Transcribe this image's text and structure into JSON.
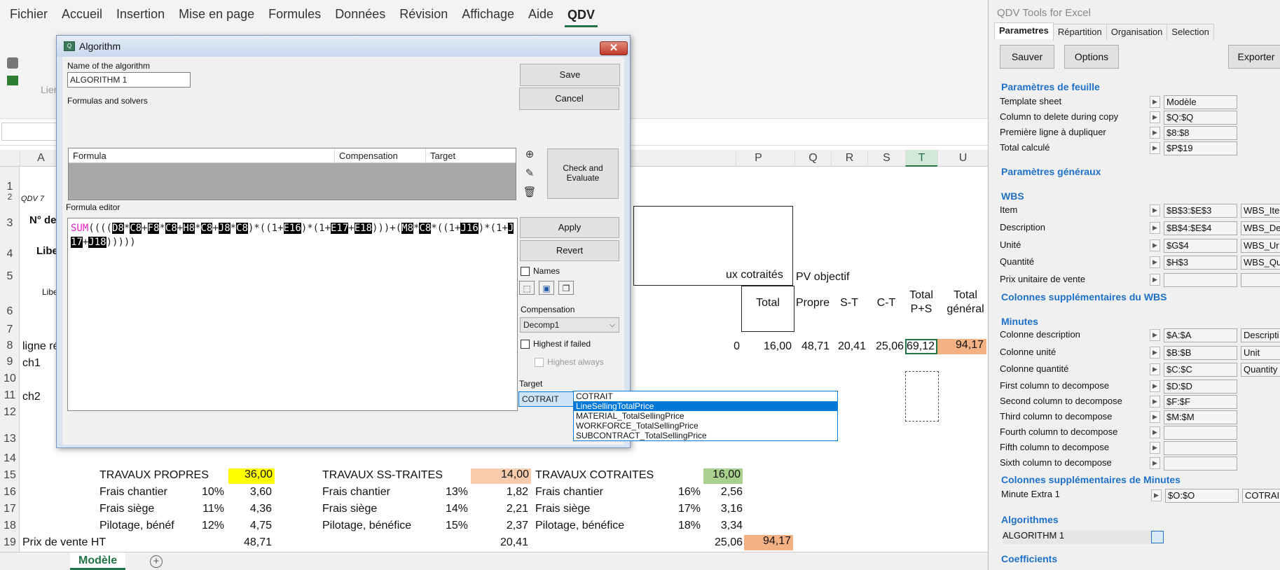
{
  "ribbon": {
    "tabs": [
      "Fichier",
      "Accueil",
      "Insertion",
      "Mise en page",
      "Formules",
      "Données",
      "Révision",
      "Affichage",
      "Aide",
      "QDV"
    ],
    "active_tab": "QDV",
    "partial_label": "Lier"
  },
  "sheet": {
    "col_letters": [
      "A",
      "P",
      "Q",
      "R",
      "S",
      "T",
      "U"
    ],
    "row_numbers": [
      "1",
      "2",
      "3",
      "4",
      "5",
      "6",
      "7",
      "8",
      "9",
      "10",
      "11",
      "12",
      "13",
      "14",
      "15",
      "16",
      "17",
      "18",
      "19"
    ],
    "cells": {
      "qdv7": "QDV 7",
      "num": "N° de p",
      "libel": "Libell",
      "libel2": "Libell",
      "ligne_ref": "ligne réf",
      "ch1": "ch1",
      "ch2": "ch2",
      "t13": "T",
      "cotraites_hdr": "ux cotraités",
      "pv_objectif": "PV objectif",
      "total": "Total",
      "propre": "Propre",
      "st": "S-T",
      "ct": "C-T",
      "total_ps": "Total P+S",
      "total_general": "Total général",
      "r8_o": "0",
      "r8_p": "16,00",
      "r8_q": "48,71",
      "r8_r": "20,41",
      "r8_s": "25,06",
      "r8_t": "69,12",
      "r8_u": "94,17",
      "trav_propres": "TRAVAUX PROPRES",
      "trav_propres_v": "36,00",
      "trav_ss": "TRAVAUX SS-TRAITES",
      "trav_ss_v": "14,00",
      "trav_co": "TRAVAUX COTRAITES",
      "trav_co_v": "16,00",
      "frais_chantier": "Frais chantier",
      "frais_siege": "Frais siège",
      "pilotage": "Pilotage, bénéf",
      "pilotage2": "Pilotage, bénéfice",
      "fc1_pct": "10%",
      "fc1_v": "3,60",
      "fs1_pct": "11%",
      "fs1_v": "4,36",
      "pb1_pct": "12%",
      "pb1_v": "4,75",
      "fc2_pct": "13%",
      "fc2_v": "1,82",
      "fs2_pct": "14%",
      "fs2_v": "2,21",
      "pb2_pct": "15%",
      "pb2_v": "2,37",
      "fc3_pct": "16%",
      "fc3_v": "2,56",
      "fs3_pct": "17%",
      "fs3_v": "3,16",
      "pb3_pct": "18%",
      "pb3_v": "3,34",
      "prix_vente": "Prix de vente HT",
      "pv1": "48,71",
      "pv2": "20,41",
      "pv3": "25,06",
      "pv4": "94,17"
    },
    "sheet_tab": "Modèle",
    "add_sheet": "+"
  },
  "qdv_panel": {
    "title": "QDV Tools for Excel",
    "tabs": [
      "Parametres",
      "Répartition",
      "Organisation",
      "Selection"
    ],
    "buttons": {
      "save": "Sauver",
      "options": "Options",
      "export": "Exporter"
    },
    "sections": {
      "feuille": "Paramètres de feuille",
      "generaux": "Paramètres généraux",
      "wbs": "WBS",
      "cols_wbs": "Colonnes supplémentaires du WBS",
      "minutes": "Minutes",
      "cols_minutes": "Colonnes supplémentaires de Minutes",
      "algorithmes": "Algorithmes",
      "coefficients": "Coefficients"
    },
    "feuille_rows": [
      {
        "label": "Template sheet",
        "value": "Modèle"
      },
      {
        "label": "Column to delete during copy",
        "value": "$Q:$Q"
      },
      {
        "label": "Première ligne à dupliquer",
        "value": "$8:$8"
      },
      {
        "label": "Total calculé",
        "value": "$P$19"
      }
    ],
    "wbs_rows": [
      {
        "label": "Item",
        "value": "$B$3:$E$3",
        "extra": "WBS_Ite"
      },
      {
        "label": "Description",
        "value": "$B$4:$E$4",
        "extra": "WBS_De"
      },
      {
        "label": "Unité",
        "value": "$G$4",
        "extra": "WBS_Ur"
      },
      {
        "label": "Quantité",
        "value": "$H$3",
        "extra": "WBS_Qu"
      },
      {
        "label": "Prix unitaire de vente",
        "value": "",
        "extra": ""
      }
    ],
    "minutes_rows": [
      {
        "label": "Colonne description",
        "value": "$A:$A",
        "extra": "Descripti"
      },
      {
        "label": "Colonne unité",
        "value": "$B:$B",
        "extra": "Unit"
      },
      {
        "label": "Colonne quantité",
        "value": "$C:$C",
        "extra": "Quantity"
      },
      {
        "label": "First column to decompose",
        "value": "$D:$D"
      },
      {
        "label": "Second column to decompose",
        "value": "$F:$F"
      },
      {
        "label": "Third column to decompose",
        "value": "$M:$M"
      },
      {
        "label": "Fourth column to decompose",
        "value": ""
      },
      {
        "label": "Fifth column to decompose",
        "value": ""
      },
      {
        "label": "Sixth column to decompose",
        "value": ""
      }
    ],
    "minute_extra": {
      "label": "Minute Extra 1",
      "value": "$O:$O",
      "extra": "COTRAI"
    },
    "algorithm_item": "ALGORITHM 1"
  },
  "dialog": {
    "title": "Algorithm",
    "close_glyph": "✕",
    "name_label": "Name of the algorithm",
    "name_value": "ALGORITHM 1",
    "formulas_label": "Formulas and solvers",
    "grid_headers": [
      "Formula",
      "Compensation",
      "Target"
    ],
    "editor_label": "Formula editor",
    "formula_tokens": [
      {
        "t": "SUM",
        "k": "fn"
      },
      {
        "t": "(((("
      },
      {
        "t": "D8",
        "k": "ref"
      },
      {
        "t": "*"
      },
      {
        "t": "C8",
        "k": "ref"
      },
      {
        "t": "+"
      },
      {
        "t": "F8",
        "k": "ref"
      },
      {
        "t": "*"
      },
      {
        "t": "C8",
        "k": "ref"
      },
      {
        "t": "+"
      },
      {
        "t": "H8",
        "k": "ref"
      },
      {
        "t": "*"
      },
      {
        "t": "C8",
        "k": "ref"
      },
      {
        "t": "+"
      },
      {
        "t": "J8",
        "k": "ref"
      },
      {
        "t": "*"
      },
      {
        "t": "C8",
        "k": "ref"
      },
      {
        "t": ")*((1+"
      },
      {
        "t": "E16",
        "k": "ref"
      },
      {
        "t": ")*(1+"
      },
      {
        "t": "E17",
        "k": "ref"
      },
      {
        "t": "+"
      },
      {
        "t": "E18",
        "k": "ref"
      },
      {
        "t": ")))+("
      },
      {
        "t": "M8",
        "k": "ref"
      },
      {
        "t": "*"
      },
      {
        "t": "C8",
        "k": "ref"
      },
      {
        "t": "*((1+"
      },
      {
        "t": "J16",
        "k": "ref"
      },
      {
        "t": ")*(1+"
      },
      {
        "t": "J17",
        "k": "ref"
      },
      {
        "t": "+"
      },
      {
        "t": "J18",
        "k": "ref"
      },
      {
        "t": ")))))"
      }
    ],
    "buttons": {
      "save": "Save",
      "cancel": "Cancel",
      "check": "Check and Evaluate",
      "apply": "Apply",
      "revert": "Revert"
    },
    "names_label": "Names",
    "compensation_label": "Compensation",
    "compensation_value": "Decomp1",
    "highest_if_failed": "Highest if failed",
    "highest_always": "Highest always",
    "target_label": "Target",
    "target_value": "COTRAIT",
    "target_options": [
      "COTRAIT",
      "LineSellingTotalPrice",
      "MATERIAL_TotalSellingPrice",
      "WORKFORCE_TotalSellingPrice",
      "SUBCONTRACT_TotalSellingPrice"
    ],
    "target_highlighted": "LineSellingTotalPrice"
  }
}
